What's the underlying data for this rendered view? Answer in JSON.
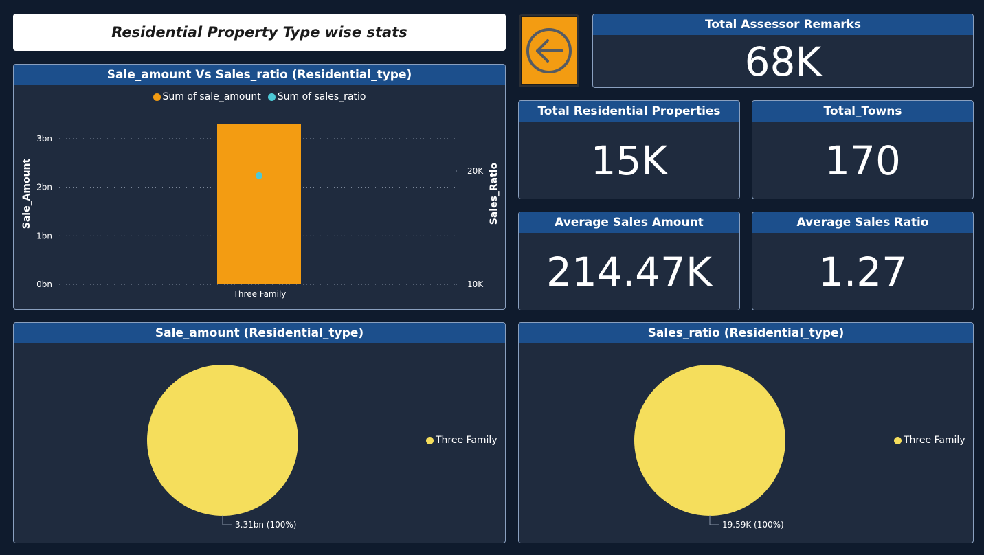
{
  "page": {
    "title": "Residential Property Type wise stats"
  },
  "back_button": {
    "icon": "arrow-left-circle-icon",
    "color": "#f39c12"
  },
  "kpis": {
    "assessor_remarks": {
      "label": "Total Assessor Remarks",
      "value": "68K"
    },
    "residential_properties": {
      "label": "Total Residential Properties",
      "value": "15K"
    },
    "towns": {
      "label": "Total_Towns",
      "value": "170"
    },
    "avg_sales_amount": {
      "label": "Average Sales Amount",
      "value": "214.47K"
    },
    "avg_sales_ratio": {
      "label": "Average Sales Ratio",
      "value": "1.27"
    }
  },
  "combo_chart": {
    "title": "Sale_amount Vs Sales_ratio (Residential_type)",
    "legend": [
      {
        "label": "Sum of sale_amount",
        "color": "#f39c12"
      },
      {
        "label": "Sum of sales_ratio",
        "color": "#4dc9d6"
      }
    ],
    "y_left_title": "Sale_Amount",
    "y_right_title": "Sales_Ratio",
    "y_left_ticks": [
      "0bn",
      "1bn",
      "2bn",
      "3bn"
    ],
    "y_right_ticks": [
      "10K",
      "20K"
    ],
    "category_label": "Three Family"
  },
  "pie_amount": {
    "title": "Sale_amount (Residential_type)",
    "legend_label": "Three Family",
    "data_label": "3.31bn (100%)",
    "color": "#f5de5c"
  },
  "pie_ratio": {
    "title": "Sales_ratio (Residential_type)",
    "legend_label": "Three Family",
    "data_label": "19.59K (100%)",
    "color": "#f5de5c"
  },
  "chart_data": [
    {
      "type": "bar",
      "title": "Sale_amount Vs Sales_ratio (Residential_type)",
      "categories": [
        "Three Family"
      ],
      "series": [
        {
          "name": "Sum of sale_amount",
          "axis": "left",
          "mark": "bar",
          "values": [
            3310000000
          ],
          "color": "#f39c12"
        },
        {
          "name": "Sum of sales_ratio",
          "axis": "right",
          "mark": "point",
          "values": [
            19590
          ],
          "color": "#4dc9d6"
        }
      ],
      "ylabel": "Sale_Amount",
      "y2label": "Sales_Ratio",
      "ylim": [
        0,
        3000000000
      ],
      "y2lim": [
        10000,
        20000
      ],
      "grid": true,
      "legend": "top"
    },
    {
      "type": "pie",
      "title": "Sale_amount (Residential_type)",
      "categories": [
        "Three Family"
      ],
      "values": [
        3310000000
      ],
      "labels": [
        "3.31bn (100%)"
      ],
      "legend": "right"
    },
    {
      "type": "pie",
      "title": "Sales_ratio (Residential_type)",
      "categories": [
        "Three Family"
      ],
      "values": [
        19590
      ],
      "labels": [
        "19.59K (100%)"
      ],
      "legend": "right"
    }
  ]
}
